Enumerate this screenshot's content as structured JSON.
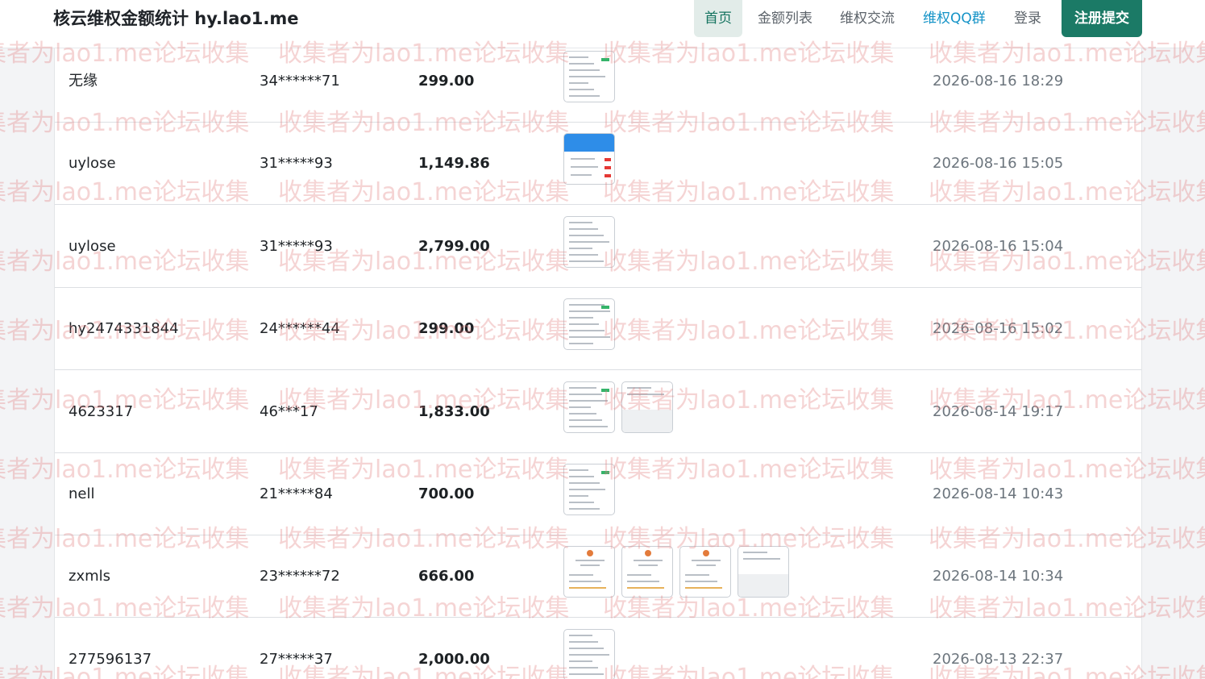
{
  "navbar": {
    "brand": "核云维权金额统计 hy.lao1.me",
    "items": [
      "首页",
      "金额列表",
      "维权交流",
      "维权QQ群",
      "登录"
    ],
    "register_label": "注册提交",
    "accent_color": "#1b7a66"
  },
  "watermark_text": "收集者为lao1.me论坛收集",
  "rows": [
    {
      "name": "无缘",
      "qq": "34******71",
      "amount": "299.00",
      "images": 1,
      "date": "2026-08-16 18:29"
    },
    {
      "name": "uylose",
      "qq": "31*****93",
      "amount": "1,149.86",
      "images": 1,
      "date": "2026-08-16 15:05"
    },
    {
      "name": "uylose",
      "qq": "31*****93",
      "amount": "2,799.00",
      "images": 1,
      "date": "2026-08-16 15:04"
    },
    {
      "name": "hy2474331844",
      "qq": "24******44",
      "amount": "299.00",
      "images": 1,
      "date": "2026-08-16 15:02"
    },
    {
      "name": "4623317",
      "qq": "46***17",
      "amount": "1,833.00",
      "images": 2,
      "date": "2026-08-14 19:17"
    },
    {
      "name": "nell",
      "qq": "21*****84",
      "amount": "700.00",
      "images": 1,
      "date": "2026-08-14 10:43"
    },
    {
      "name": "zxmls",
      "qq": "23******72",
      "amount": "666.00",
      "images": 4,
      "date": "2026-08-14 10:34"
    },
    {
      "name": "277596137",
      "qq": "27*****37",
      "amount": "2,000.00",
      "images": 1,
      "date": "2026-08-13 22:37"
    }
  ]
}
